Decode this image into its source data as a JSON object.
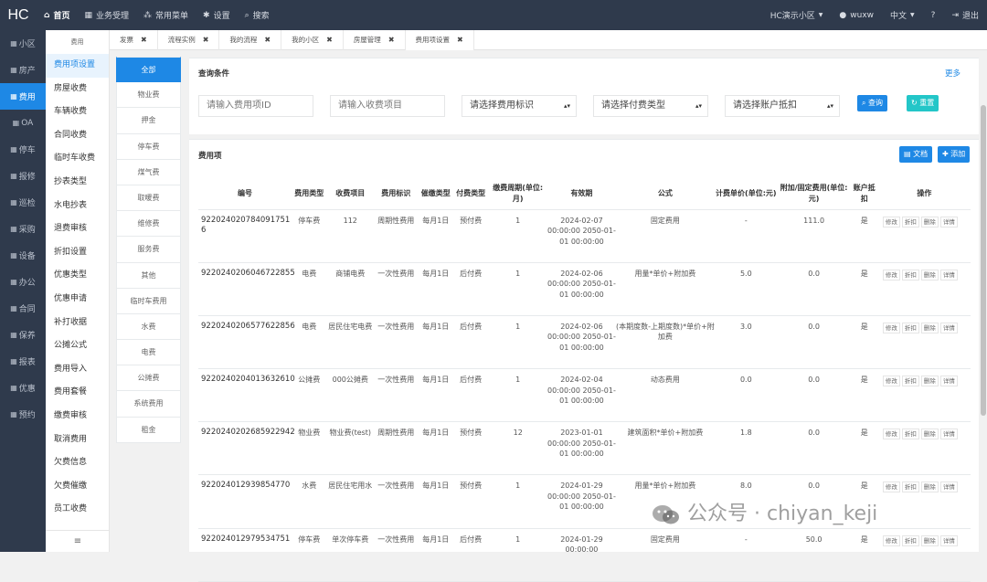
{
  "top": {
    "logo": "HC",
    "nav": [
      {
        "icon": "home-icon",
        "glyph": "⌂",
        "label": "首页"
      },
      {
        "icon": "table-icon",
        "glyph": "▦",
        "label": "业务受理"
      },
      {
        "icon": "sitemap-icon",
        "glyph": "⁂",
        "label": "常用菜单"
      },
      {
        "icon": "gear-icon",
        "glyph": "✱",
        "label": "设置"
      },
      {
        "icon": "search-icon",
        "glyph": "⌕",
        "label": "搜索"
      }
    ],
    "community": "HC演示小区",
    "user": "wuxw",
    "lang": "中文",
    "help_glyph": "?",
    "logout": "退出"
  },
  "sidebar": {
    "items": [
      "小区",
      "房产",
      "费用",
      "OA",
      "停车",
      "报修",
      "巡检",
      "采购",
      "设备",
      "办公",
      "合同",
      "保养",
      "报表",
      "优惠",
      "预约"
    ]
  },
  "menu2": {
    "title": "费用",
    "items": [
      "费用项设置",
      "房屋收费",
      "车辆收费",
      "合同收费",
      "临时车收费",
      "抄表类型",
      "水电抄表",
      "退费审核",
      "折扣设置",
      "优惠类型",
      "优惠申请",
      "补打收据",
      "公摊公式",
      "费用导入",
      "费用套餐",
      "缴费审核",
      "取消费用",
      "欠费信息",
      "欠费催缴",
      "员工收费"
    ],
    "foot": "≡"
  },
  "tabs": [
    {
      "label": "发票"
    },
    {
      "label": "流程实例"
    },
    {
      "label": "我的流程"
    },
    {
      "label": "我的小区"
    },
    {
      "label": "房屋管理"
    },
    {
      "label": "费用项设置"
    }
  ],
  "cats": [
    "全部",
    "物业费",
    "押金",
    "停车费",
    "煤气费",
    "取暖费",
    "维修费",
    "服务费",
    "其他",
    "临时车费用",
    "水费",
    "电费",
    "公摊费",
    "系统费用",
    "租金"
  ],
  "query": {
    "title": "查询条件",
    "more": "更多",
    "id_placeholder": "请输入费用项ID",
    "name_placeholder": "请输入收费项目",
    "flag_select": "请选择费用标识",
    "paytype_select": "请选择付费类型",
    "account_select": "请选择账户抵扣",
    "search_btn": "查询",
    "reset_btn": "重置"
  },
  "table": {
    "title": "费用项",
    "doc_btn": "文档",
    "add_btn": "添加",
    "headers": [
      "编号",
      "费用类型",
      "收费项目",
      "费用标识",
      "催缴类型",
      "付费类型",
      "缴费周期(单位:月)",
      "有效期",
      "公式",
      "计费单价(单位:元)",
      "附加/固定费用(单位:元)",
      "账户抵扣",
      "操作"
    ],
    "ops": [
      "修改",
      "折扣",
      "删除",
      "详情"
    ],
    "rows": [
      [
        "922024020784091751​6",
        "停车费",
        "112",
        "周期性费用",
        "每月1日",
        "预付费",
        "1",
        "2024-02-07 00:00:00 2050-01-01 00:00:00",
        "固定费用",
        "-",
        "111.0",
        "是"
      ],
      [
        "9220240206046722855",
        "电费",
        "商铺电费",
        "一次性费用",
        "每月1日",
        "后付费",
        "1",
        "2024-02-06 00:00:00 2050-01-01 00:00:00",
        "用量*单价+附加费",
        "5.0",
        "0.0",
        "是"
      ],
      [
        "9220240206577622856",
        "电费",
        "居民住宅电费",
        "一次性费用",
        "每月1日",
        "后付费",
        "1",
        "2024-02-06 00:00:00 2050-01-01 00:00:00",
        "(本期度数-上期度数)*单价+附加费",
        "3.0",
        "0.0",
        "是"
      ],
      [
        "9220240204013632610",
        "公摊费",
        "000公摊费",
        "一次性费用",
        "每月1日",
        "后付费",
        "1",
        "2024-02-04 00:00:00 2050-01-01 00:00:00",
        "动态费用",
        "0.0",
        "0.0",
        "是"
      ],
      [
        "9220240202685922942",
        "物业费",
        "物业费(test)",
        "周期性费用",
        "每月1日",
        "预付费",
        "12",
        "2023-01-01 00:00:00 2050-01-01 00:00:00",
        "建筑面积*单价+附加费",
        "1.8",
        "0.0",
        "是"
      ],
      [
        "922024012939854770",
        "水费",
        "居民住宅用水",
        "一次性费用",
        "每月1日",
        "预付费",
        "1",
        "2024-01-29 00:00:00 2050-01-01 00:00:00",
        "用量*单价+附加费",
        "8.0",
        "0.0",
        "是"
      ],
      [
        "922024012979534751",
        "停车费",
        "单次停车费",
        "一次性费用",
        "每月1日",
        "后付费",
        "1",
        "2024-01-29 00:00:00",
        "固定费用",
        "-",
        "50.0",
        "是"
      ]
    ]
  },
  "watermark": "公众号 · chiyan_keji"
}
